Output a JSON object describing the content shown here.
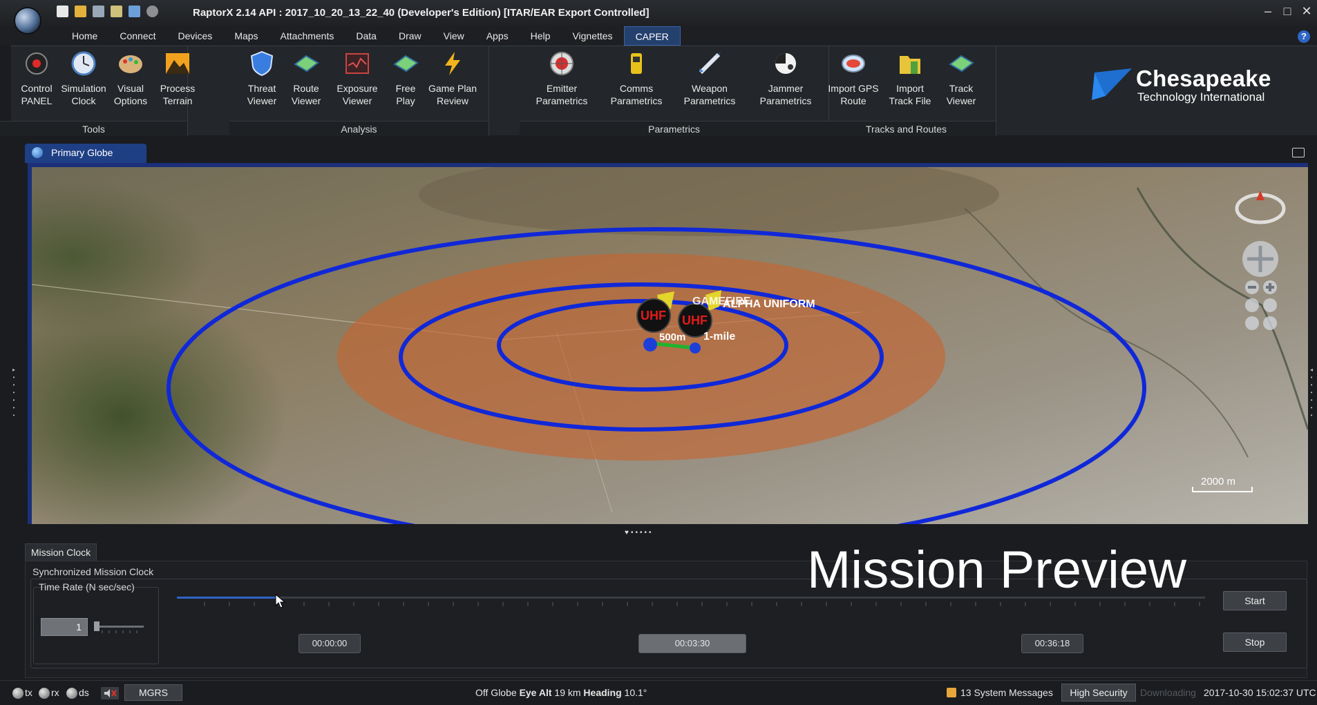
{
  "app": {
    "title": "RaptorX 2.14 API : 2017_10_20_13_22_40 (Developer's Edition) [ITAR/EAR Export Controlled]",
    "window_controls": [
      "–",
      "□",
      "✕"
    ]
  },
  "menu": {
    "items": [
      "Home",
      "Connect",
      "Devices",
      "Maps",
      "Attachments",
      "Data",
      "Draw",
      "View",
      "Apps",
      "Help",
      "Vignettes",
      "CAPER"
    ],
    "active": "CAPER"
  },
  "ribbon": {
    "groups": [
      {
        "caption": "Tools",
        "buttons": [
          {
            "label": "Control\nPANEL",
            "icon": "control-panel-icon"
          },
          {
            "label": "Simulation\nClock",
            "icon": "simulation-clock-icon"
          },
          {
            "label": "Visual\nOptions",
            "icon": "palette-icon"
          },
          {
            "label": "Process\nTerrain",
            "icon": "terrain-icon"
          }
        ]
      },
      {
        "caption": "Analysis",
        "buttons": [
          {
            "label": "Threat\nViewer",
            "icon": "shield-icon"
          },
          {
            "label": "Route\nViewer",
            "icon": "aircraft-icon"
          },
          {
            "label": "Exposure\nViewer",
            "icon": "exposure-icon"
          },
          {
            "label": "Free\nPlay",
            "icon": "aircraft-icon"
          },
          {
            "label": "Game Plan\nReview",
            "icon": "lightning-icon"
          }
        ]
      },
      {
        "caption": "Parametrics",
        "buttons": [
          {
            "label": "Emitter\nParametrics",
            "icon": "emitter-icon"
          },
          {
            "label": "Comms\nParametrics",
            "icon": "radio-icon"
          },
          {
            "label": "Weapon\nParametrics",
            "icon": "missile-icon"
          },
          {
            "label": "Jammer\nParametrics",
            "icon": "jammer-icon"
          }
        ]
      },
      {
        "caption": "Tracks and Routes",
        "buttons": [
          {
            "label": "Import GPS\nRoute",
            "icon": "gps-icon"
          },
          {
            "label": "Import\nTrack File",
            "icon": "folder-icon"
          },
          {
            "label": "Track\nViewer",
            "icon": "aircraft-icon"
          }
        ]
      }
    ]
  },
  "logo": {
    "name": "Chesapeake",
    "subtitle": "Technology International"
  },
  "globe": {
    "tab_label": "Primary Globe",
    "labels": {
      "alpha_uniform": "ALPHA UNIFORM",
      "gamefire": "GAMEFIRE",
      "one_mile": "1-mile",
      "half_mile": "500m",
      "uhf_1": "UHF",
      "uhf_2": "UHF"
    },
    "scale_label": "2000 m",
    "colors": {
      "range_ring": "#1028d8",
      "threat_zone": "#c7642f"
    }
  },
  "mission_clock": {
    "tab_label": "Mission Clock",
    "group_label": "Synchronized Mission Clock",
    "time_rate_label": "Time Rate (N sec/sec)",
    "time_rate_value": "1",
    "preview_text": "Mission Preview",
    "start_time": "00:00:00",
    "current_time": "00:03:30",
    "end_time": "00:36:18",
    "progress": 0.096,
    "start_label": "Start",
    "stop_label": "Stop"
  },
  "status": {
    "tx": "tx",
    "rx": "rx",
    "ds": "ds",
    "mgrs": "MGRS",
    "off_globe": "Off Globe",
    "eye_alt_label": "Eye Alt",
    "eye_alt_value": "19 km",
    "heading_label": "Heading",
    "heading_value": "10.1°",
    "messages": "13 System Messages",
    "security": "High Security",
    "downloading": "Downloading",
    "timestamp": "2017-10-30 15:02:37 UTC"
  }
}
